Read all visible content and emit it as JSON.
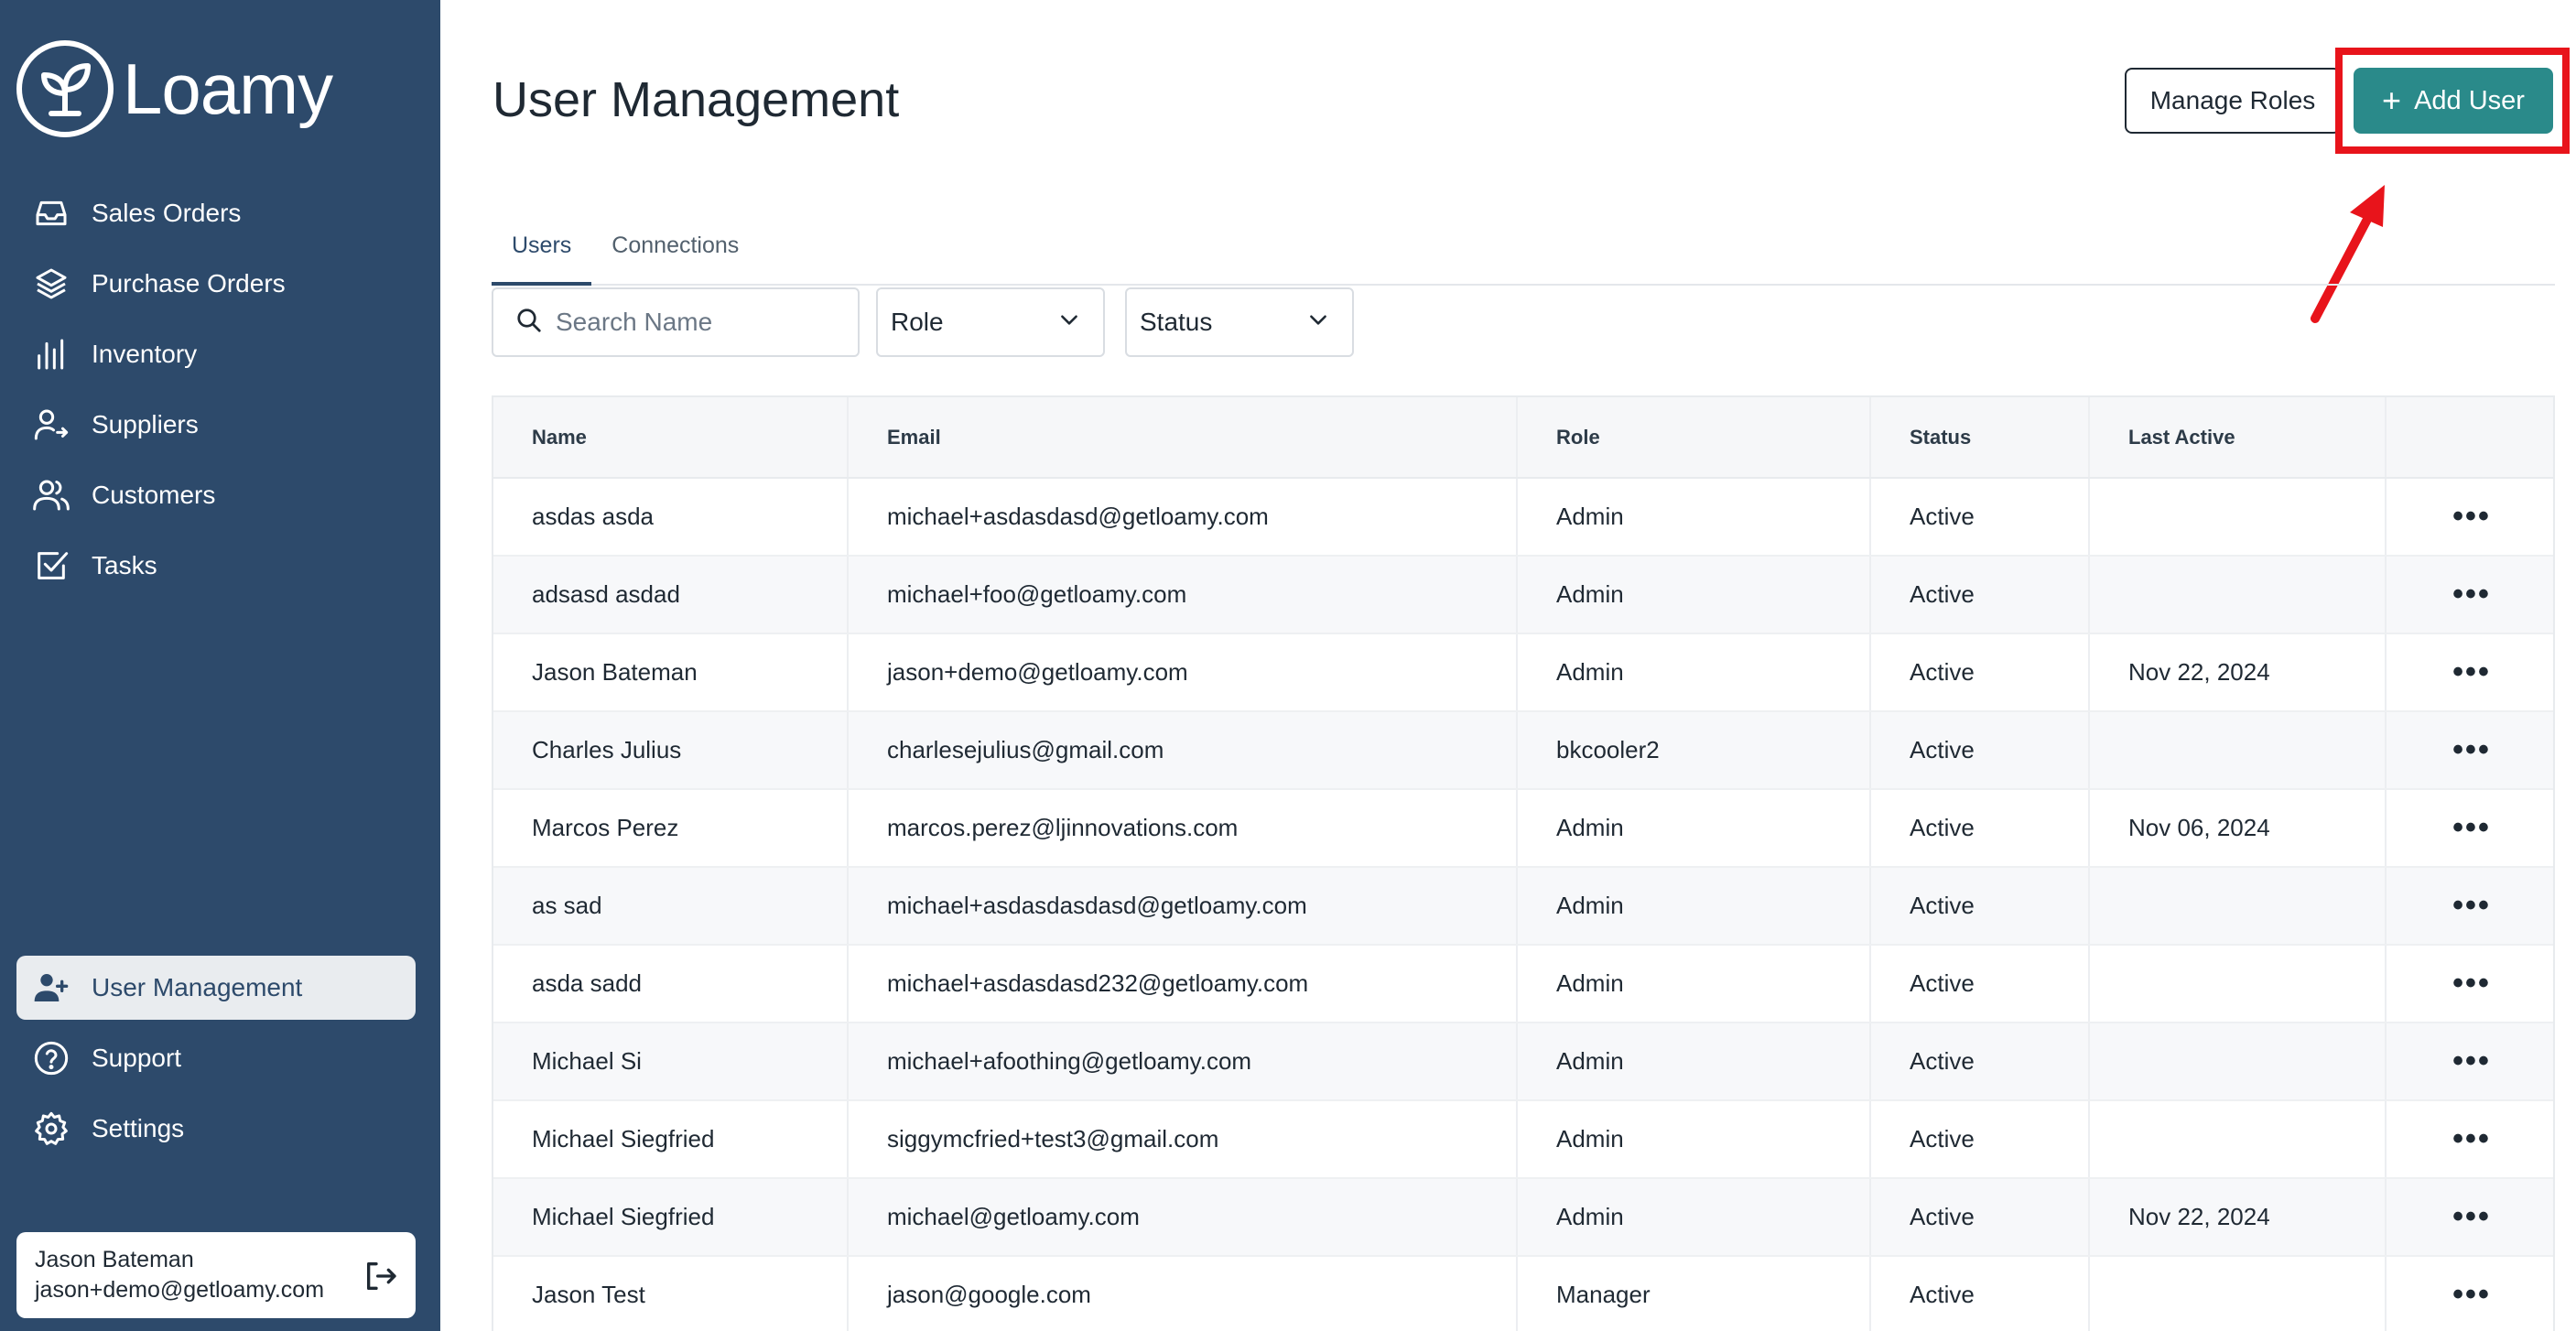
{
  "brand": {
    "name": "Loamy"
  },
  "sidebar": {
    "items": [
      {
        "label": "Sales Orders",
        "icon": "inbox-tray-icon"
      },
      {
        "label": "Purchase Orders",
        "icon": "layers-icon"
      },
      {
        "label": "Inventory",
        "icon": "bar-chart-icon"
      },
      {
        "label": "Suppliers",
        "icon": "user-arrow-icon"
      },
      {
        "label": "Customers",
        "icon": "users-icon"
      },
      {
        "label": "Tasks",
        "icon": "checkbox-icon"
      }
    ],
    "bottom_items": [
      {
        "label": "User Management",
        "icon": "user-plus-icon",
        "active": true
      },
      {
        "label": "Support",
        "icon": "help-circle-icon"
      },
      {
        "label": "Settings",
        "icon": "gear-icon"
      }
    ],
    "user": {
      "name": "Jason Bateman",
      "email": "jason+demo@getloamy.com"
    }
  },
  "header": {
    "title": "User Management",
    "manage_roles_label": "Manage Roles",
    "add_user_label": "Add User"
  },
  "tabs": [
    {
      "label": "Users",
      "active": true
    },
    {
      "label": "Connections",
      "active": false
    }
  ],
  "filters": {
    "search_placeholder": "Search Name",
    "role_label": "Role",
    "status_label": "Status"
  },
  "table": {
    "columns": [
      "Name",
      "Email",
      "Role",
      "Status",
      "Last Active",
      ""
    ],
    "rows": [
      {
        "name": "asdas asda",
        "email": "michael+asdasdasd@getloamy.com",
        "role": "Admin",
        "status": "Active",
        "last_active": ""
      },
      {
        "name": "adsasd asdad",
        "email": "michael+foo@getloamy.com",
        "role": "Admin",
        "status": "Active",
        "last_active": ""
      },
      {
        "name": "Jason Bateman",
        "email": "jason+demo@getloamy.com",
        "role": "Admin",
        "status": "Active",
        "last_active": "Nov 22, 2024"
      },
      {
        "name": "Charles Julius",
        "email": "charlesejulius@gmail.com",
        "role": "bkcooler2",
        "status": "Active",
        "last_active": ""
      },
      {
        "name": "Marcos Perez",
        "email": "marcos.perez@ljinnovations.com",
        "role": "Admin",
        "status": "Active",
        "last_active": "Nov 06, 2024"
      },
      {
        "name": "as sad",
        "email": "michael+asdasdasdasd@getloamy.com",
        "role": "Admin",
        "status": "Active",
        "last_active": ""
      },
      {
        "name": "asda sadd",
        "email": "michael+asdasdasd232@getloamy.com",
        "role": "Admin",
        "status": "Active",
        "last_active": ""
      },
      {
        "name": "Michael Si",
        "email": "michael+afoothing@getloamy.com",
        "role": "Admin",
        "status": "Active",
        "last_active": ""
      },
      {
        "name": "Michael Siegfried",
        "email": "siggymcfried+test3@gmail.com",
        "role": "Admin",
        "status": "Active",
        "last_active": ""
      },
      {
        "name": "Michael Siegfried",
        "email": "michael@getloamy.com",
        "role": "Admin",
        "status": "Active",
        "last_active": "Nov 22, 2024"
      },
      {
        "name": "Jason Test",
        "email": "jason@google.com",
        "role": "Manager",
        "status": "Active",
        "last_active": ""
      }
    ],
    "row_action_label": "•••"
  },
  "colors": {
    "sidebar_bg": "#2d4a6b",
    "accent": "#2a8a8a",
    "annotation": "#e8141b"
  }
}
